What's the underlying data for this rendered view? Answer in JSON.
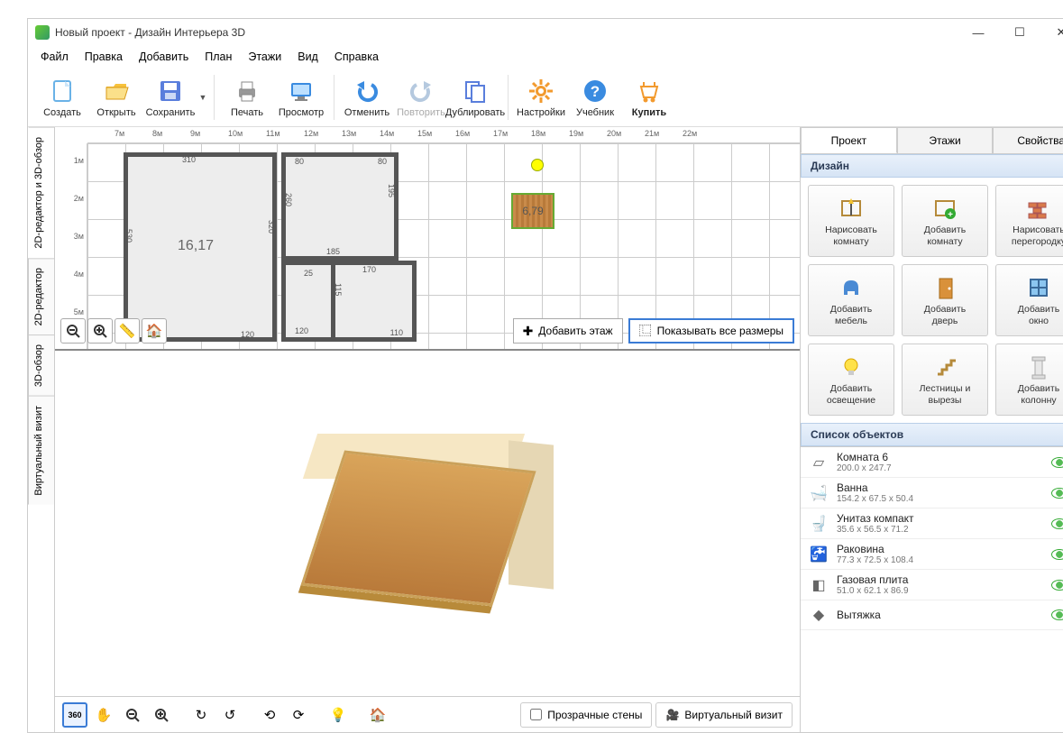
{
  "title": "Новый проект - Дизайн Интерьера 3D",
  "menu": [
    "Файл",
    "Правка",
    "Добавить",
    "План",
    "Этажи",
    "Вид",
    "Справка"
  ],
  "toolbar": [
    {
      "id": "new",
      "label": "Создать",
      "color": "#fff",
      "stroke": "#6ab2e7"
    },
    {
      "id": "open",
      "label": "Открыть",
      "color": "#f7c23c"
    },
    {
      "id": "save",
      "label": "Сохранить",
      "color": "#5a7edc"
    },
    {
      "id": "sep"
    },
    {
      "id": "print",
      "label": "Печать",
      "color": "#888"
    },
    {
      "id": "preview",
      "label": "Просмотр",
      "color": "#3a8be0"
    },
    {
      "id": "sep"
    },
    {
      "id": "undo",
      "label": "Отменить",
      "color": "#3a8be0"
    },
    {
      "id": "redo",
      "label": "Повторить",
      "color": "#b5c9df",
      "muted": true
    },
    {
      "id": "dup",
      "label": "Дублировать",
      "color": "#5a7edc"
    },
    {
      "id": "sep"
    },
    {
      "id": "settings",
      "label": "Настройки",
      "color": "#f29a2e"
    },
    {
      "id": "help",
      "label": "Учебник",
      "color": "#3a8be0"
    },
    {
      "id": "buy",
      "label": "Купить",
      "color": "#f29a2e",
      "bold": true
    }
  ],
  "vtabs": [
    {
      "id": "both",
      "label": "2D-редактор и 3D-обзор",
      "active": true
    },
    {
      "id": "2d",
      "label": "2D-редактор"
    },
    {
      "id": "3d",
      "label": "3D-обзор"
    },
    {
      "id": "vv",
      "label": "Виртуальный визит"
    }
  ],
  "ruler_h": [
    "7м",
    "8м",
    "9м",
    "10м",
    "11м",
    "12м",
    "13м",
    "14м",
    "15м",
    "16м",
    "17м",
    "18м",
    "19м",
    "20м",
    "21м",
    "22м"
  ],
  "ruler_v": [
    "1м",
    "2м",
    "3м",
    "4м",
    "5м"
  ],
  "plan": {
    "room1_area": "16,17",
    "room2_area": "6,79",
    "dims": {
      "w310": "310",
      "w320": "320",
      "w530": "530",
      "w80a": "80",
      "w80b": "80",
      "w260": "260",
      "w185": "185",
      "w195": "195",
      "w170": "170",
      "w115": "115",
      "w120": "120",
      "w110": "110",
      "w25": "25",
      "w120b": "120"
    },
    "btn_addfloor": "Добавить этаж",
    "btn_showdims": "Показывать все размеры"
  },
  "bottom": {
    "transparent": "Прозрачные стены",
    "virtual": "Виртуальный визит"
  },
  "rtabs": [
    "Проект",
    "Этажи",
    "Свойства"
  ],
  "section_design": "Дизайн",
  "design_buttons": [
    {
      "id": "draw-room",
      "l1": "Нарисовать",
      "l2": "комнату"
    },
    {
      "id": "add-room",
      "l1": "Добавить",
      "l2": "комнату"
    },
    {
      "id": "draw-wall",
      "l1": "Нарисовать",
      "l2": "перегородку"
    },
    {
      "id": "add-furn",
      "l1": "Добавить",
      "l2": "мебель"
    },
    {
      "id": "add-door",
      "l1": "Добавить",
      "l2": "дверь"
    },
    {
      "id": "add-window",
      "l1": "Добавить",
      "l2": "окно"
    },
    {
      "id": "add-light",
      "l1": "Добавить",
      "l2": "освещение"
    },
    {
      "id": "stairs",
      "l1": "Лестницы и",
      "l2": "вырезы"
    },
    {
      "id": "add-column",
      "l1": "Добавить",
      "l2": "колонну"
    }
  ],
  "section_objects": "Список объектов",
  "objects": [
    {
      "name": "Комната 6",
      "dim": "200.0 x 247.7",
      "icon": "room"
    },
    {
      "name": "Ванна",
      "dim": "154.2 x 67.5 x 50.4",
      "icon": "bath"
    },
    {
      "name": "Унитаз компакт",
      "dim": "35.6 x 56.5 x 71.2",
      "icon": "toilet"
    },
    {
      "name": "Раковина",
      "dim": "77.3 x 72.5 x 108.4",
      "icon": "sink"
    },
    {
      "name": "Газовая плита",
      "dim": "51.0 x 62.1 x 86.9",
      "icon": "stove"
    },
    {
      "name": "Вытяжка",
      "dim": "",
      "icon": "hood"
    }
  ]
}
